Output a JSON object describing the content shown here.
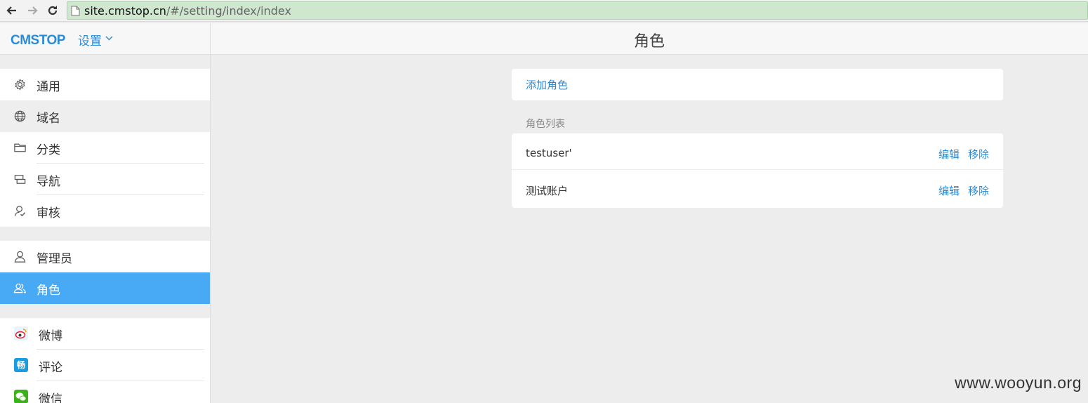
{
  "browser": {
    "url_host": "site.cmstop.cn",
    "url_path": "/#/setting/index/index"
  },
  "sidebar": {
    "logo_text": "CMSTOP",
    "settings_label": "设置",
    "groups": [
      {
        "items": [
          {
            "label": "通用",
            "icon": "gear-icon"
          },
          {
            "label": "域名",
            "icon": "globe-icon"
          },
          {
            "label": "分类",
            "icon": "folder-icon"
          },
          {
            "label": "导航",
            "icon": "navigation-icon"
          },
          {
            "label": "审核",
            "icon": "review-icon"
          }
        ]
      },
      {
        "items": [
          {
            "label": "管理员",
            "icon": "user-icon"
          },
          {
            "label": "角色",
            "icon": "users-icon",
            "active": true
          }
        ]
      },
      {
        "items": [
          {
            "label": "微博",
            "icon": "weibo-icon"
          },
          {
            "label": "评论",
            "icon": "changyan-icon",
            "icon_text": "畅"
          },
          {
            "label": "微信",
            "icon": "wechat-icon"
          }
        ]
      }
    ]
  },
  "main": {
    "title": "角色",
    "add_role_label": "添加角色",
    "list_title": "角色列表",
    "roles": [
      {
        "name": "testuser'",
        "edit": "编辑",
        "remove": "移除"
      },
      {
        "name": "测试账户",
        "edit": "编辑",
        "remove": "移除"
      }
    ]
  },
  "watermark": "www.wooyun.org",
  "colors": {
    "accent": "#2b8bd6",
    "active_bg": "#48a9f5",
    "address_bar": "#cfe7cf"
  }
}
